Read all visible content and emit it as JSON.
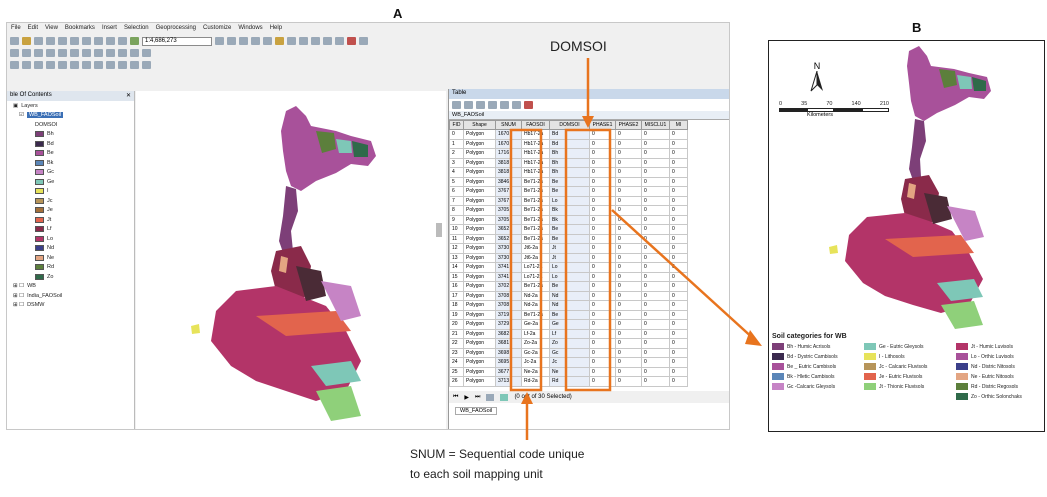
{
  "labels": {
    "panel_a": "A",
    "panel_b": "B"
  },
  "gis": {
    "menu": [
      "File",
      "Edit",
      "View",
      "Bookmarks",
      "Insert",
      "Selection",
      "Geoprocessing",
      "Customize",
      "Windows",
      "Help"
    ],
    "scale_value": "1:4,686,273",
    "toc": {
      "title": "ble Of Contents",
      "layers_label": "Layers",
      "layer1": "WB_FAOSoil",
      "field": "DOMSOI",
      "classes": [
        {
          "code": "Bh",
          "color": "#7d3f78"
        },
        {
          "code": "Bd",
          "color": "#3b2a4e"
        },
        {
          "code": "Be",
          "color": "#a8519a"
        },
        {
          "code": "Bk",
          "color": "#5b86b8"
        },
        {
          "code": "Gc",
          "color": "#c684c5"
        },
        {
          "code": "Ge",
          "color": "#7ec7b7"
        },
        {
          "code": "I",
          "color": "#e7e35a"
        },
        {
          "code": "Jc",
          "color": "#b7955a"
        },
        {
          "code": "Je",
          "color": "#a3703b"
        },
        {
          "code": "Jt",
          "color": "#e2644d"
        },
        {
          "code": "Lf",
          "color": "#8a2a4a"
        },
        {
          "code": "Lo",
          "color": "#b33468"
        },
        {
          "code": "Nd",
          "color": "#3b3f8a"
        },
        {
          "code": "Ne",
          "color": "#e3a582"
        },
        {
          "code": "Rd",
          "color": "#5c7f3c"
        },
        {
          "code": "Zo",
          "color": "#2f6a4a"
        }
      ],
      "other_layers": [
        "WB",
        "India_FAOSoil",
        "DSMW"
      ]
    },
    "table": {
      "title": "Table",
      "name": "WB_FAOSoil",
      "columns": [
        "FID",
        "Shape",
        "SNUM",
        "FAOSOI",
        "DOMSOI",
        "PHASE1",
        "PHASE2",
        "MISCLU1",
        "MI"
      ],
      "rows": [
        [
          "0",
          "Polygon",
          "1670",
          "Hb17-2a",
          "Bd",
          "0",
          "0",
          "0",
          "0"
        ],
        [
          "1",
          "Polygon",
          "1670",
          "Hb17-2a",
          "Bd",
          "0",
          "0",
          "0",
          "0"
        ],
        [
          "2",
          "Polygon",
          "1716",
          "Hb17-2a",
          "Bh",
          "0",
          "0",
          "0",
          "0"
        ],
        [
          "3",
          "Polygon",
          "3818",
          "Hb17-2a",
          "Bh",
          "0",
          "0",
          "0",
          "0"
        ],
        [
          "4",
          "Polygon",
          "3818",
          "Hb17-2a",
          "Bh",
          "0",
          "0",
          "0",
          "0"
        ],
        [
          "5",
          "Polygon",
          "3846",
          "Be71-2a",
          "Be",
          "0",
          "0",
          "0",
          "0"
        ],
        [
          "6",
          "Polygon",
          "3767",
          "Be71-2a",
          "Be",
          "0",
          "0",
          "0",
          "0"
        ],
        [
          "7",
          "Polygon",
          "3767",
          "Be71-2a",
          "Lo",
          "0",
          "0",
          "0",
          "0"
        ],
        [
          "8",
          "Polygon",
          "3705",
          "Be71-2a",
          "Bk",
          "0",
          "0",
          "0",
          "0"
        ],
        [
          "9",
          "Polygon",
          "3705",
          "Be71-2a",
          "Bk",
          "0",
          "0",
          "0",
          "0"
        ],
        [
          "10",
          "Polygon",
          "3652",
          "Be71-2a",
          "Be",
          "0",
          "0",
          "0",
          "0"
        ],
        [
          "11",
          "Polygon",
          "3652",
          "Be71-2a",
          "Be",
          "0",
          "0",
          "0",
          "0"
        ],
        [
          "12",
          "Polygon",
          "3730",
          "Jt6-2a",
          "Jt",
          "0",
          "0",
          "0",
          "0"
        ],
        [
          "13",
          "Polygon",
          "3730",
          "Jt6-2a",
          "Jt",
          "0",
          "0",
          "0",
          "0"
        ],
        [
          "14",
          "Polygon",
          "3741",
          "Lo71-2a",
          "Lo",
          "0",
          "0",
          "0",
          "0"
        ],
        [
          "15",
          "Polygon",
          "3741",
          "Lo71-2a",
          "Lo",
          "0",
          "0",
          "0",
          "0"
        ],
        [
          "16",
          "Polygon",
          "3702",
          "Be71-2a",
          "Be",
          "0",
          "0",
          "0",
          "0"
        ],
        [
          "17",
          "Polygon",
          "3708",
          "Nd-2a",
          "Nd",
          "0",
          "0",
          "0",
          "0"
        ],
        [
          "18",
          "Polygon",
          "3708",
          "Nd-2a",
          "Nd",
          "0",
          "0",
          "0",
          "0"
        ],
        [
          "19",
          "Polygon",
          "3719",
          "Be71-2a",
          "Be",
          "0",
          "0",
          "0",
          "0"
        ],
        [
          "20",
          "Polygon",
          "3729",
          "Ge-2a",
          "Ge",
          "0",
          "0",
          "0",
          "0"
        ],
        [
          "21",
          "Polygon",
          "3682",
          "Lf-2a",
          "Lf",
          "0",
          "0",
          "0",
          "0"
        ],
        [
          "22",
          "Polygon",
          "3681",
          "Zo-2a",
          "Zo",
          "0",
          "0",
          "0",
          "0"
        ],
        [
          "23",
          "Polygon",
          "3698",
          "Gc-2a",
          "Gc",
          "0",
          "0",
          "0",
          "0"
        ],
        [
          "24",
          "Polygon",
          "3695",
          "Jc-2a",
          "Jc",
          "0",
          "0",
          "0",
          "0"
        ],
        [
          "25",
          "Polygon",
          "3677",
          "Ne-2a",
          "Ne",
          "0",
          "0",
          "0",
          "0"
        ],
        [
          "26",
          "Polygon",
          "3713",
          "Rd-2a",
          "Rd",
          "0",
          "0",
          "0",
          "0"
        ]
      ],
      "status": "(0 out of 30 Selected)",
      "tab": "WB_FAOSoil"
    }
  },
  "annotations": {
    "domsoi": "DOMSOI",
    "snum_line1": "SNUM = Sequential code unique",
    "snum_line2": "to each soil mapping unit"
  },
  "mapB": {
    "north": "N",
    "scale_ticks": [
      "0",
      "35",
      "70",
      "140",
      "210"
    ],
    "scale_unit": "Kilometers",
    "legend_title": "Soil categories for WB",
    "legend": [
      {
        "label": "Bh - Humic Acrisols",
        "color": "#7d3f78"
      },
      {
        "label": "Ge - Eutric Gleysols",
        "color": "#7ec7b7"
      },
      {
        "label": "Jt - Humic Luvisols",
        "color": "#b33468"
      },
      {
        "label": "Bd - Dystric Cambisols",
        "color": "#3b2a4e"
      },
      {
        "label": "I - Lithosols",
        "color": "#e7e35a"
      },
      {
        "label": "Lo - Orthic Luvisols",
        "color": "#a8519a"
      },
      {
        "label": "Be _ Eutric Cambisols",
        "color": "#a8519a"
      },
      {
        "label": "Jc - Calcaric Fluvisols",
        "color": "#b7955a"
      },
      {
        "label": "Nd - Distric Nitosols",
        "color": "#3b3f8a"
      },
      {
        "label": "Bk - Hletic Cambisols",
        "color": "#5b86b8"
      },
      {
        "label": "Je - Eutric Fluvisols",
        "color": "#e2644d"
      },
      {
        "label": "Ne - Eutric Nitosols",
        "color": "#e3a582"
      },
      {
        "label": "Gc -Calcaric Gleysols",
        "color": "#c684c5"
      },
      {
        "label": "Jt - Thionic Fluvisols",
        "color": "#8fd07a"
      },
      {
        "label": "Rd - Distric Regosols",
        "color": "#5c7f3c"
      },
      {
        "label": "",
        "color": ""
      },
      {
        "label": "",
        "color": ""
      },
      {
        "label": "Zo - Orthic Solonchaks",
        "color": "#2f6a4a"
      }
    ]
  }
}
